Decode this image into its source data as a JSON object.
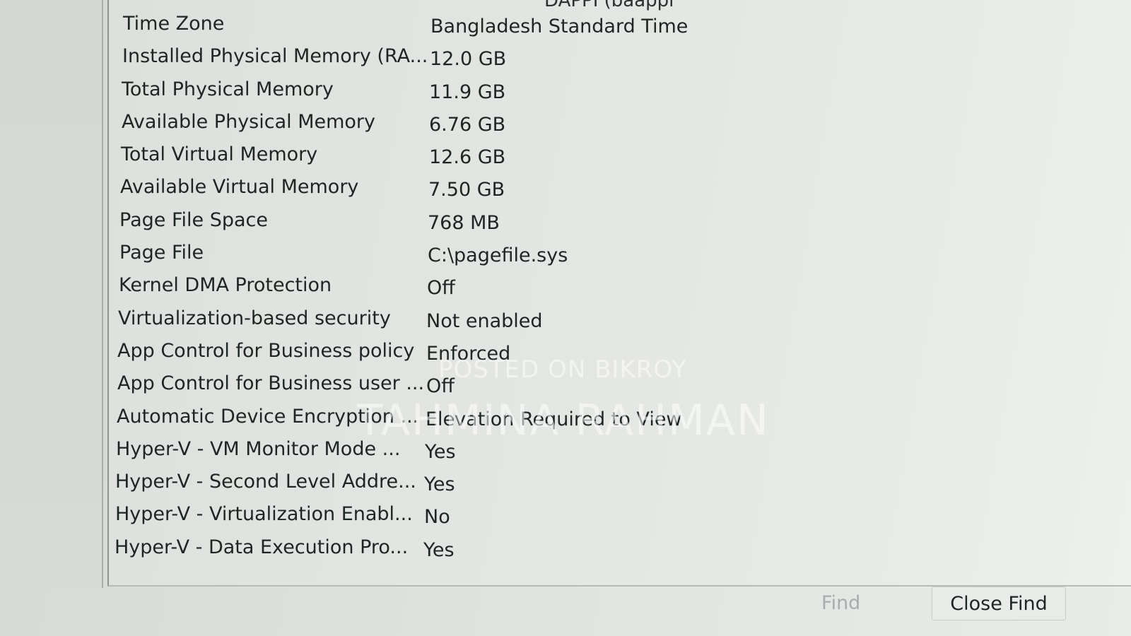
{
  "top_cut_text": "DAPPI (baappi",
  "rows": [
    {
      "name": "Time Zone",
      "value": "Bangladesh Standard Time"
    },
    {
      "name": "Installed Physical Memory (RA...",
      "value": "12.0 GB"
    },
    {
      "name": "Total Physical Memory",
      "value": "11.9 GB"
    },
    {
      "name": "Available Physical Memory",
      "value": "6.76 GB"
    },
    {
      "name": "Total Virtual Memory",
      "value": "12.6 GB"
    },
    {
      "name": "Available Virtual Memory",
      "value": "7.50 GB"
    },
    {
      "name": "Page File Space",
      "value": "768 MB"
    },
    {
      "name": "Page File",
      "value": "C:\\pagefile.sys"
    },
    {
      "name": "Kernel DMA Protection",
      "value": "Off"
    },
    {
      "name": "Virtualization-based security",
      "value": "Not enabled"
    },
    {
      "name": "App Control for Business policy",
      "value": "Enforced"
    },
    {
      "name": "App Control for Business user ...",
      "value": "Off"
    },
    {
      "name": "Automatic Device Encryption ...",
      "value": "Elevation Required to View"
    },
    {
      "name": "Hyper-V - VM Monitor Mode ...",
      "value": "Yes"
    },
    {
      "name": "Hyper-V - Second Level Addre...",
      "value": "Yes"
    },
    {
      "name": "Hyper-V - Virtualization Enabl...",
      "value": "No"
    },
    {
      "name": "Hyper-V - Data Execution Pro...",
      "value": "Yes"
    }
  ],
  "watermark": {
    "line1": "POSTED ON BIKROY",
    "line2": "TAHMINA RAHMAN"
  },
  "footer": {
    "find_label": "Find",
    "close_find_label": "Close Find"
  }
}
